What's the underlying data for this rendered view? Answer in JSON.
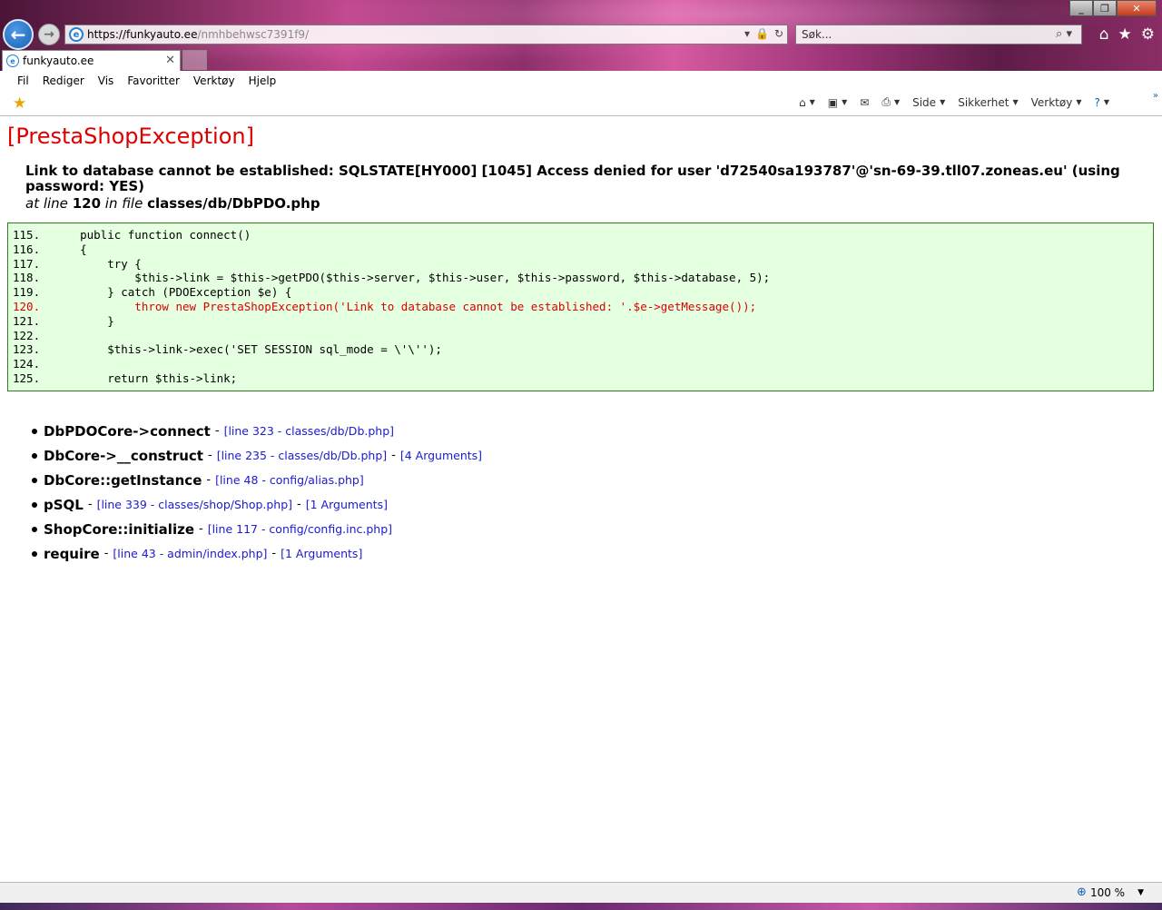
{
  "browser": {
    "address": {
      "host": "https://funkyauto.ee",
      "path": "/nmhbehwsc7391f9/"
    },
    "search_placeholder": "Søk...",
    "tab": {
      "title": "funkyauto.ee"
    },
    "menu": [
      "Fil",
      "Rediger",
      "Vis",
      "Favoritter",
      "Verktøy",
      "Hjelp"
    ],
    "commands": {
      "page": "Side",
      "security": "Sikkerhet",
      "tools": "Verktøy"
    },
    "zoom": "100 %"
  },
  "error": {
    "title": "[PrestaShopException]",
    "message": "Link to database cannot be established: SQLSTATE[HY000] [1045] Access denied for user 'd72540sa193787'@'sn-69-39.tll07.zoneas.eu' (using password: YES)",
    "location": {
      "prefix": "at line",
      "line": "120",
      "mid": "in file",
      "file": "classes/db/DbPDO.php"
    }
  },
  "code": [
    {
      "n": "115.",
      "text": "    public function connect()",
      "hl": false
    },
    {
      "n": "116.",
      "text": "    {",
      "hl": false
    },
    {
      "n": "117.",
      "text": "        try {",
      "hl": false
    },
    {
      "n": "118.",
      "text": "            $this->link = $this->getPDO($this->server, $this->user, $this->password, $this->database, 5);",
      "hl": false
    },
    {
      "n": "119.",
      "text": "        } catch (PDOException $e) {",
      "hl": false
    },
    {
      "n": "120.",
      "text": "            throw new PrestaShopException('Link to database cannot be established: '.$e->getMessage());",
      "hl": true
    },
    {
      "n": "121.",
      "text": "        }",
      "hl": false
    },
    {
      "n": "122.",
      "text": "",
      "hl": false
    },
    {
      "n": "123.",
      "text": "        $this->link->exec('SET SESSION sql_mode = \\'\\'');",
      "hl": false
    },
    {
      "n": "124.",
      "text": "",
      "hl": false
    },
    {
      "n": "125.",
      "text": "        return $this->link;",
      "hl": false
    }
  ],
  "trace": [
    {
      "fn": "DbPDOCore->connect",
      "link": "[line 323 - classes/db/Db.php]",
      "args": ""
    },
    {
      "fn": "DbCore->__construct",
      "link": "[line 235 - classes/db/Db.php]",
      "args": "[4 Arguments]"
    },
    {
      "fn": "DbCore::getInstance",
      "link": "[line 48 - config/alias.php]",
      "args": ""
    },
    {
      "fn": "pSQL",
      "link": "[line 339 - classes/shop/Shop.php]",
      "args": "[1 Arguments]"
    },
    {
      "fn": "ShopCore::initialize",
      "link": "[line 117 - config/config.inc.php]",
      "args": ""
    },
    {
      "fn": "require",
      "link": "[line 43 - admin/index.php]",
      "args": "[1 Arguments]"
    }
  ]
}
